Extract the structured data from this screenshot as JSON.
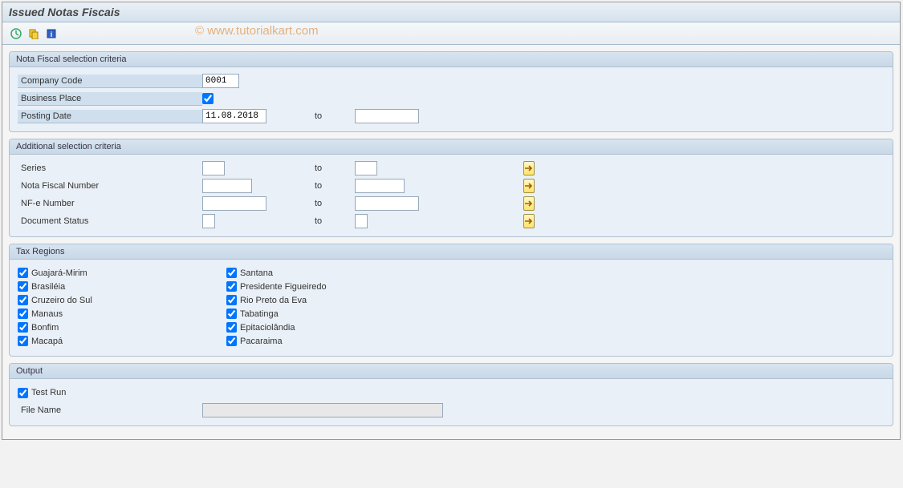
{
  "title": "Issued Notas Fiscais",
  "watermark": "© www.tutorialkart.com",
  "groups": {
    "nf": {
      "title": "Nota Fiscal selection criteria",
      "company_code_label": "Company Code",
      "company_code_value": "0001",
      "business_place_label": "Business Place",
      "business_place_checked": true,
      "posting_date_label": "Posting Date",
      "posting_date_from": "11.08.2018",
      "posting_date_to": "",
      "to_label": "to"
    },
    "add": {
      "title": "Additional selection criteria",
      "to_label": "to",
      "series_label": "Series",
      "series_from": "",
      "series_to": "",
      "nfnum_label": "Nota Fiscal Number",
      "nfnum_from": "",
      "nfnum_to": "",
      "nfe_label": "NF-e Number",
      "nfe_from": "",
      "nfe_to": "",
      "docstat_label": "Document Status",
      "docstat_from": "",
      "docstat_to": ""
    },
    "tax": {
      "title": "Tax Regions",
      "col1": [
        "Guajará-Mirim",
        "Brasiléia",
        "Cruzeiro do Sul",
        "Manaus",
        "Bonfim",
        "Macapá"
      ],
      "col2": [
        "Santana",
        "Presidente Figueiredo",
        "Rio Preto da Eva",
        "Tabatinga",
        "Epitaciolândia",
        "Pacaraima"
      ]
    },
    "out": {
      "title": "Output",
      "testrun_label": "Test Run",
      "testrun_checked": true,
      "filename_label": "File Name",
      "filename_value": ""
    }
  }
}
